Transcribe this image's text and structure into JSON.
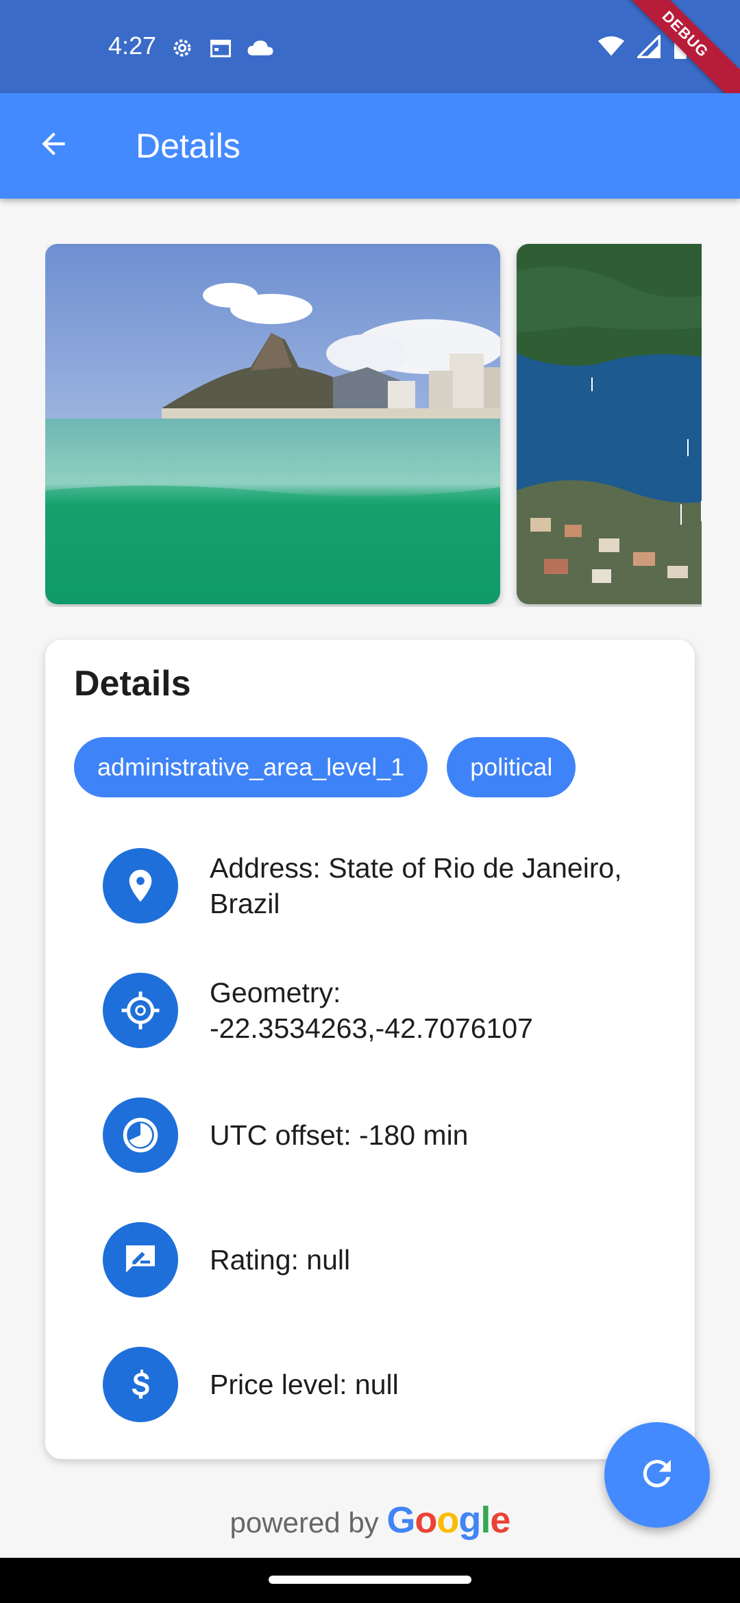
{
  "status_bar": {
    "time": "4:27",
    "debug_label": "DEBUG",
    "icons_left": [
      "settings-icon",
      "calendar-icon",
      "cloud-icon"
    ],
    "icons_right": [
      "wifi-icon",
      "signal-icon",
      "battery-icon"
    ]
  },
  "app_bar": {
    "title": "Details",
    "back_icon": "arrow-back-icon"
  },
  "gallery": {
    "photos": [
      "beach-photo",
      "bay-photo"
    ]
  },
  "details": {
    "title": "Details",
    "chips": [
      "administrative_area_level_1",
      "political"
    ],
    "rows": [
      {
        "icon": "location-pin-icon",
        "text": "Address: State of Rio de Janeiro, Brazil"
      },
      {
        "icon": "gps-target-icon",
        "text": "Geometry: -22.3534263,-42.7076107"
      },
      {
        "icon": "clock-icon",
        "text": "UTC offset: -180 min"
      },
      {
        "icon": "rate-review-icon",
        "text": "Rating: null"
      },
      {
        "icon": "dollar-icon",
        "text": "Price level: null"
      }
    ]
  },
  "fab": {
    "icon": "refresh-icon"
  },
  "footer": {
    "powered_by": "powered by",
    "google": [
      "G",
      "o",
      "o",
      "g",
      "l",
      "e"
    ]
  },
  "colors": {
    "status_bar": "#3a6bc8",
    "app_bar": "#448aff",
    "chip": "#3f83f8",
    "icon_circle": "#1e6fd9",
    "debug_ribbon": "#b71c38"
  }
}
